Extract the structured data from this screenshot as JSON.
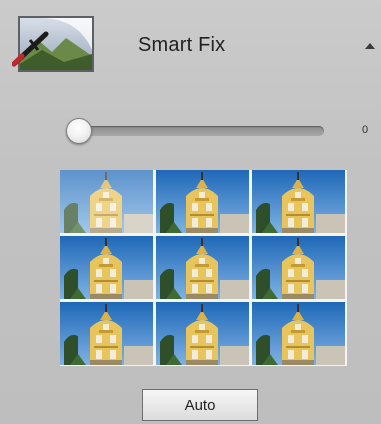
{
  "panel": {
    "title": "Smart Fix",
    "tool_icon": "smart-fix-landscape-icon",
    "collapse_icon": "triangle-up-icon"
  },
  "slider": {
    "value": 0,
    "value_text": "0",
    "min": 0,
    "max": 100
  },
  "grid": {
    "rows": 3,
    "columns": 3,
    "selected_index": 0,
    "thumbnail_subject": "yellow-building-preview"
  },
  "auto_button": {
    "label": "Auto"
  },
  "colors": {
    "panel_background": "#c2c2c2",
    "selection_border": "#3cb3e8",
    "building": "#e7c45c",
    "sky": "#1f68b8"
  }
}
